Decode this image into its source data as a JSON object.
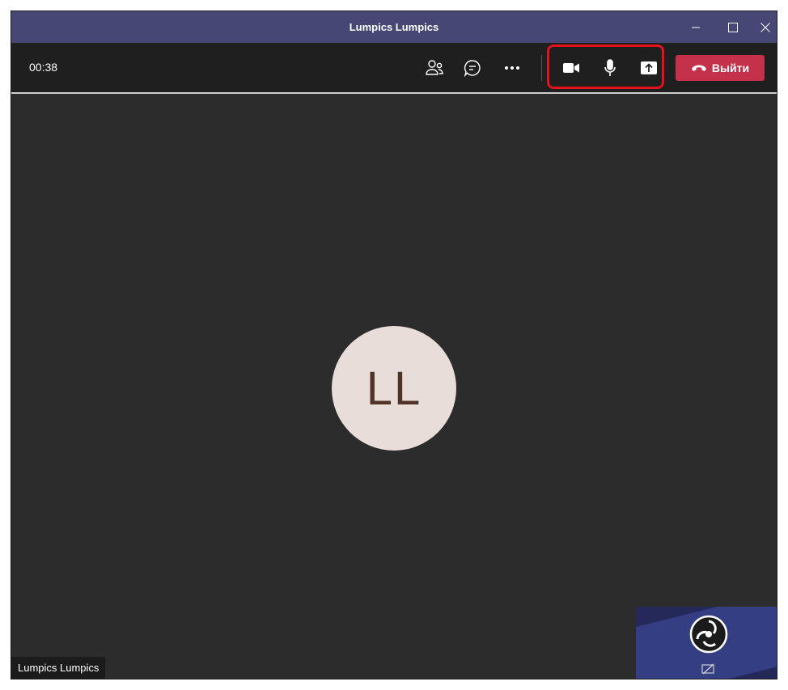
{
  "window": {
    "title": "Lumpics Lumpics",
    "controls": {
      "minimize": "minimize-icon",
      "maximize": "maximize-icon",
      "close": "close-icon"
    }
  },
  "toolbar": {
    "timer": "00:38",
    "icons": [
      "participants-icon",
      "chat-icon",
      "more-options-icon",
      "camera-icon",
      "microphone-icon",
      "share-screen-icon"
    ],
    "leave_label": "Выйти",
    "leave_color": "#c4314b",
    "highlight_color": "#e0121b"
  },
  "stage": {
    "avatar_initials": "LL",
    "avatar_bg": "#e8ddd8",
    "participant_name": "Lumpics Lumpics",
    "self_preview": {
      "logo": "obs-logo-icon",
      "status_icon": "camera-off-icon"
    }
  },
  "colors": {
    "titlebar": "#464775",
    "toolbar": "#1f1f1f",
    "stage": "#2d2c2c"
  }
}
